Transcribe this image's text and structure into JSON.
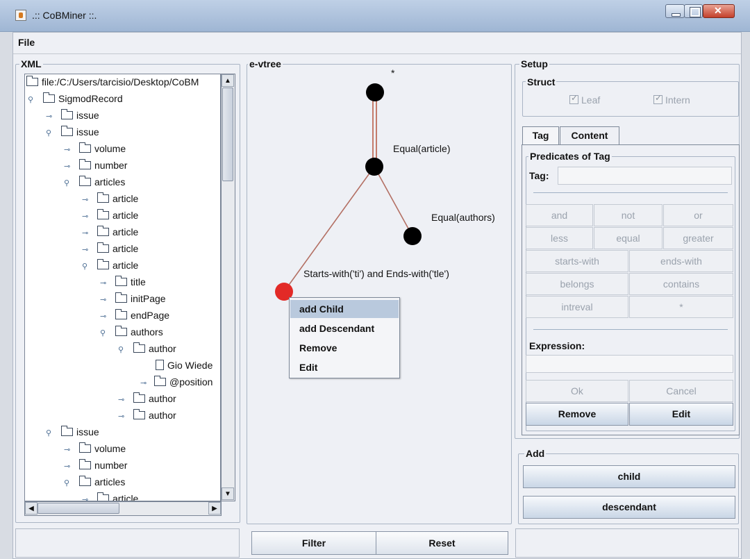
{
  "window": {
    "title": ".:: CoBMiner ::."
  },
  "menu": {
    "file": "File"
  },
  "xml_panel": {
    "label": "XML",
    "nodes": [
      "file:/C:/Users/tarcisio/Desktop/CoBM",
      "SigmodRecord",
      "issue",
      "issue",
      "volume",
      "number",
      "articles",
      "article",
      "article",
      "article",
      "article",
      "article",
      "title",
      "initPage",
      "endPage",
      "authors",
      "author",
      "Gio Wiede",
      "@position",
      "author",
      "author",
      "issue",
      "volume",
      "number",
      "articles",
      "article"
    ]
  },
  "evtree_panel": {
    "label": "e-vtree",
    "root_label": "*",
    "edge_labels": [
      "Equal(article)",
      "Equal(authors)",
      "Starts-with('ti') and Ends-with('tle')"
    ],
    "context_menu": [
      "add Child",
      "add Descendant",
      "Remove",
      "Edit"
    ],
    "filter_button": "Filter",
    "reset_button": "Reset"
  },
  "setup_panel": {
    "label": "Setup",
    "struct": {
      "label": "Struct",
      "leaf": "Leaf",
      "intern": "Intern"
    },
    "tabs": [
      "Tag",
      "Content"
    ],
    "predicates": {
      "label": "Predicates of Tag",
      "tag_label": "Tag:",
      "tag_value": "",
      "row1": [
        "and",
        "not",
        "or"
      ],
      "row2": [
        "less",
        "equal",
        "greater"
      ],
      "row3": [
        "starts-with",
        "ends-with"
      ],
      "row4": [
        "belongs",
        "contains"
      ],
      "row5": [
        "intreval",
        "*"
      ],
      "expression_label": "Expression:",
      "expression_value": "",
      "ok": "Ok",
      "cancel": "Cancel",
      "remove": "Remove",
      "edit": "Edit"
    },
    "add": {
      "label": "Add",
      "child": "child",
      "descendant": "descendant"
    }
  }
}
